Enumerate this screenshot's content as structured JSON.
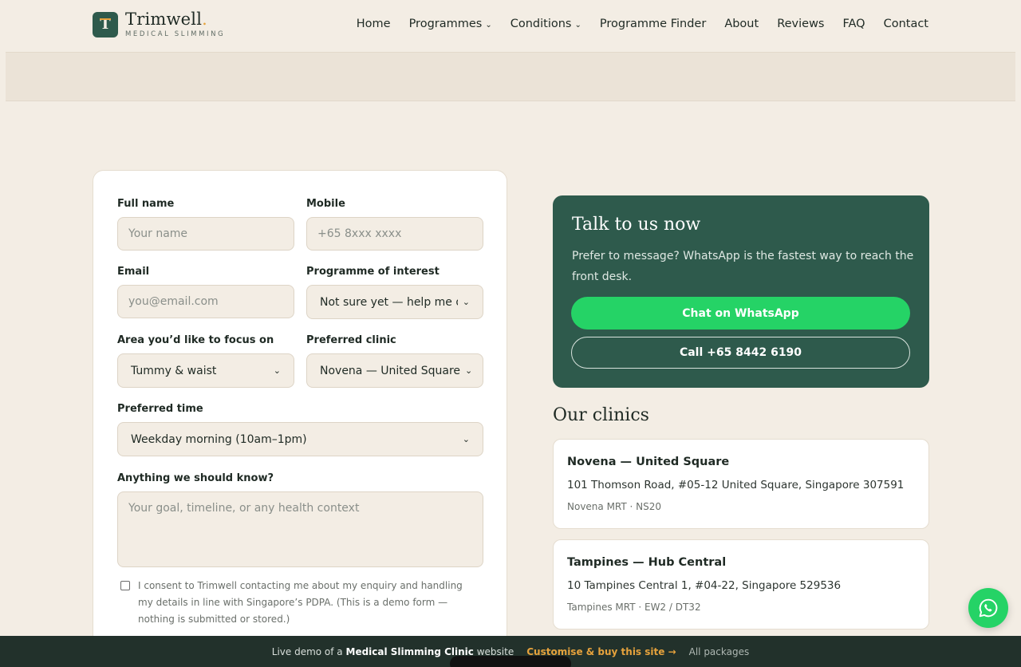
{
  "brand": {
    "mark": "T",
    "name": "Trimwell",
    "name_dot": ".",
    "subtitle": "MEDICAL SLIMMING"
  },
  "nav": [
    {
      "label": "Home",
      "has_dropdown": false
    },
    {
      "label": "Programmes",
      "has_dropdown": true
    },
    {
      "label": "Conditions",
      "has_dropdown": true
    },
    {
      "label": "Programme Finder",
      "has_dropdown": false
    },
    {
      "label": "About",
      "has_dropdown": false
    },
    {
      "label": "Reviews",
      "has_dropdown": false
    },
    {
      "label": "FAQ",
      "has_dropdown": false
    },
    {
      "label": "Contact",
      "has_dropdown": false
    }
  ],
  "form": {
    "full_name": {
      "label": "Full name",
      "placeholder": "Your name"
    },
    "mobile": {
      "label": "Mobile",
      "placeholder": "+65 8xxx xxxx"
    },
    "email": {
      "label": "Email",
      "placeholder": "you@email.com"
    },
    "programme": {
      "label": "Programme of interest",
      "value": "Not sure yet — help me decide"
    },
    "area": {
      "label": "Area you’d like to focus on",
      "value": "Tummy & waist"
    },
    "clinic": {
      "label": "Preferred clinic",
      "value": "Novena — United Square"
    },
    "time": {
      "label": "Preferred time",
      "value": "Weekday morning (10am–1pm)"
    },
    "notes": {
      "label": "Anything we should know?",
      "placeholder": "Your goal, timeline, or any health context"
    },
    "consent_text": "I consent to Trimwell contacting me about my enquiry and handling my details in line with Singapore’s PDPA. (This is a demo form — nothing is submitted or stored.)"
  },
  "talk": {
    "title": "Talk to us now",
    "description": "Prefer to message? WhatsApp is the fastest way to reach the front desk.",
    "whatsapp_label": "Chat on WhatsApp",
    "call_label": "Call +65 8442 6190"
  },
  "clinics": {
    "title": "Our clinics",
    "items": [
      {
        "name": "Novena — United Square",
        "address": "101 Thomson Road, #05-12 United Square, Singapore 307591",
        "mrt": "Novena MRT · NS20"
      },
      {
        "name": "Tampines — Hub Central",
        "address": "10 Tampines Central 1, #04-22, Singapore 529536",
        "mrt": "Tampines MRT · EW2 / DT32"
      }
    ]
  },
  "demo_bar": {
    "prefix": "Live demo of a",
    "site_type": "Medical Slimming Clinic",
    "suffix": "website",
    "cta": "Customise & buy this site →",
    "packages": "All packages"
  },
  "icons": {
    "fab": "whatsapp-icon",
    "chevron": "chevron-down-icon"
  },
  "colors": {
    "primary": "#2e5a4c",
    "whatsapp": "#25d366",
    "accent": "#e6a23c",
    "background": "#f3ede4"
  }
}
